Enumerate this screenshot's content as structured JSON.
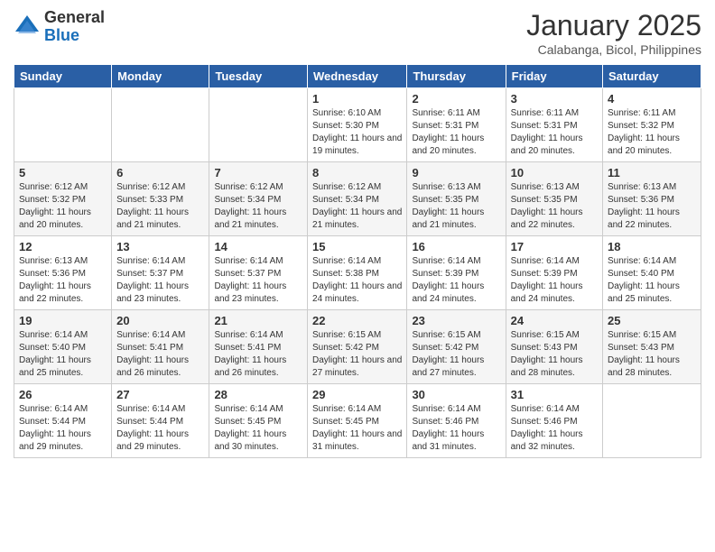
{
  "logo": {
    "general": "General",
    "blue": "Blue"
  },
  "header": {
    "month": "January 2025",
    "location": "Calabanga, Bicol, Philippines"
  },
  "days_of_week": [
    "Sunday",
    "Monday",
    "Tuesday",
    "Wednesday",
    "Thursday",
    "Friday",
    "Saturday"
  ],
  "weeks": [
    [
      {
        "day": "",
        "info": ""
      },
      {
        "day": "",
        "info": ""
      },
      {
        "day": "",
        "info": ""
      },
      {
        "day": "1",
        "info": "Sunrise: 6:10 AM\nSunset: 5:30 PM\nDaylight: 11 hours and 19 minutes."
      },
      {
        "day": "2",
        "info": "Sunrise: 6:11 AM\nSunset: 5:31 PM\nDaylight: 11 hours and 20 minutes."
      },
      {
        "day": "3",
        "info": "Sunrise: 6:11 AM\nSunset: 5:31 PM\nDaylight: 11 hours and 20 minutes."
      },
      {
        "day": "4",
        "info": "Sunrise: 6:11 AM\nSunset: 5:32 PM\nDaylight: 11 hours and 20 minutes."
      }
    ],
    [
      {
        "day": "5",
        "info": "Sunrise: 6:12 AM\nSunset: 5:32 PM\nDaylight: 11 hours and 20 minutes."
      },
      {
        "day": "6",
        "info": "Sunrise: 6:12 AM\nSunset: 5:33 PM\nDaylight: 11 hours and 21 minutes."
      },
      {
        "day": "7",
        "info": "Sunrise: 6:12 AM\nSunset: 5:34 PM\nDaylight: 11 hours and 21 minutes."
      },
      {
        "day": "8",
        "info": "Sunrise: 6:12 AM\nSunset: 5:34 PM\nDaylight: 11 hours and 21 minutes."
      },
      {
        "day": "9",
        "info": "Sunrise: 6:13 AM\nSunset: 5:35 PM\nDaylight: 11 hours and 21 minutes."
      },
      {
        "day": "10",
        "info": "Sunrise: 6:13 AM\nSunset: 5:35 PM\nDaylight: 11 hours and 22 minutes."
      },
      {
        "day": "11",
        "info": "Sunrise: 6:13 AM\nSunset: 5:36 PM\nDaylight: 11 hours and 22 minutes."
      }
    ],
    [
      {
        "day": "12",
        "info": "Sunrise: 6:13 AM\nSunset: 5:36 PM\nDaylight: 11 hours and 22 minutes."
      },
      {
        "day": "13",
        "info": "Sunrise: 6:14 AM\nSunset: 5:37 PM\nDaylight: 11 hours and 23 minutes."
      },
      {
        "day": "14",
        "info": "Sunrise: 6:14 AM\nSunset: 5:37 PM\nDaylight: 11 hours and 23 minutes."
      },
      {
        "day": "15",
        "info": "Sunrise: 6:14 AM\nSunset: 5:38 PM\nDaylight: 11 hours and 24 minutes."
      },
      {
        "day": "16",
        "info": "Sunrise: 6:14 AM\nSunset: 5:39 PM\nDaylight: 11 hours and 24 minutes."
      },
      {
        "day": "17",
        "info": "Sunrise: 6:14 AM\nSunset: 5:39 PM\nDaylight: 11 hours and 24 minutes."
      },
      {
        "day": "18",
        "info": "Sunrise: 6:14 AM\nSunset: 5:40 PM\nDaylight: 11 hours and 25 minutes."
      }
    ],
    [
      {
        "day": "19",
        "info": "Sunrise: 6:14 AM\nSunset: 5:40 PM\nDaylight: 11 hours and 25 minutes."
      },
      {
        "day": "20",
        "info": "Sunrise: 6:14 AM\nSunset: 5:41 PM\nDaylight: 11 hours and 26 minutes."
      },
      {
        "day": "21",
        "info": "Sunrise: 6:14 AM\nSunset: 5:41 PM\nDaylight: 11 hours and 26 minutes."
      },
      {
        "day": "22",
        "info": "Sunrise: 6:15 AM\nSunset: 5:42 PM\nDaylight: 11 hours and 27 minutes."
      },
      {
        "day": "23",
        "info": "Sunrise: 6:15 AM\nSunset: 5:42 PM\nDaylight: 11 hours and 27 minutes."
      },
      {
        "day": "24",
        "info": "Sunrise: 6:15 AM\nSunset: 5:43 PM\nDaylight: 11 hours and 28 minutes."
      },
      {
        "day": "25",
        "info": "Sunrise: 6:15 AM\nSunset: 5:43 PM\nDaylight: 11 hours and 28 minutes."
      }
    ],
    [
      {
        "day": "26",
        "info": "Sunrise: 6:14 AM\nSunset: 5:44 PM\nDaylight: 11 hours and 29 minutes."
      },
      {
        "day": "27",
        "info": "Sunrise: 6:14 AM\nSunset: 5:44 PM\nDaylight: 11 hours and 29 minutes."
      },
      {
        "day": "28",
        "info": "Sunrise: 6:14 AM\nSunset: 5:45 PM\nDaylight: 11 hours and 30 minutes."
      },
      {
        "day": "29",
        "info": "Sunrise: 6:14 AM\nSunset: 5:45 PM\nDaylight: 11 hours and 31 minutes."
      },
      {
        "day": "30",
        "info": "Sunrise: 6:14 AM\nSunset: 5:46 PM\nDaylight: 11 hours and 31 minutes."
      },
      {
        "day": "31",
        "info": "Sunrise: 6:14 AM\nSunset: 5:46 PM\nDaylight: 11 hours and 32 minutes."
      },
      {
        "day": "",
        "info": ""
      }
    ]
  ]
}
